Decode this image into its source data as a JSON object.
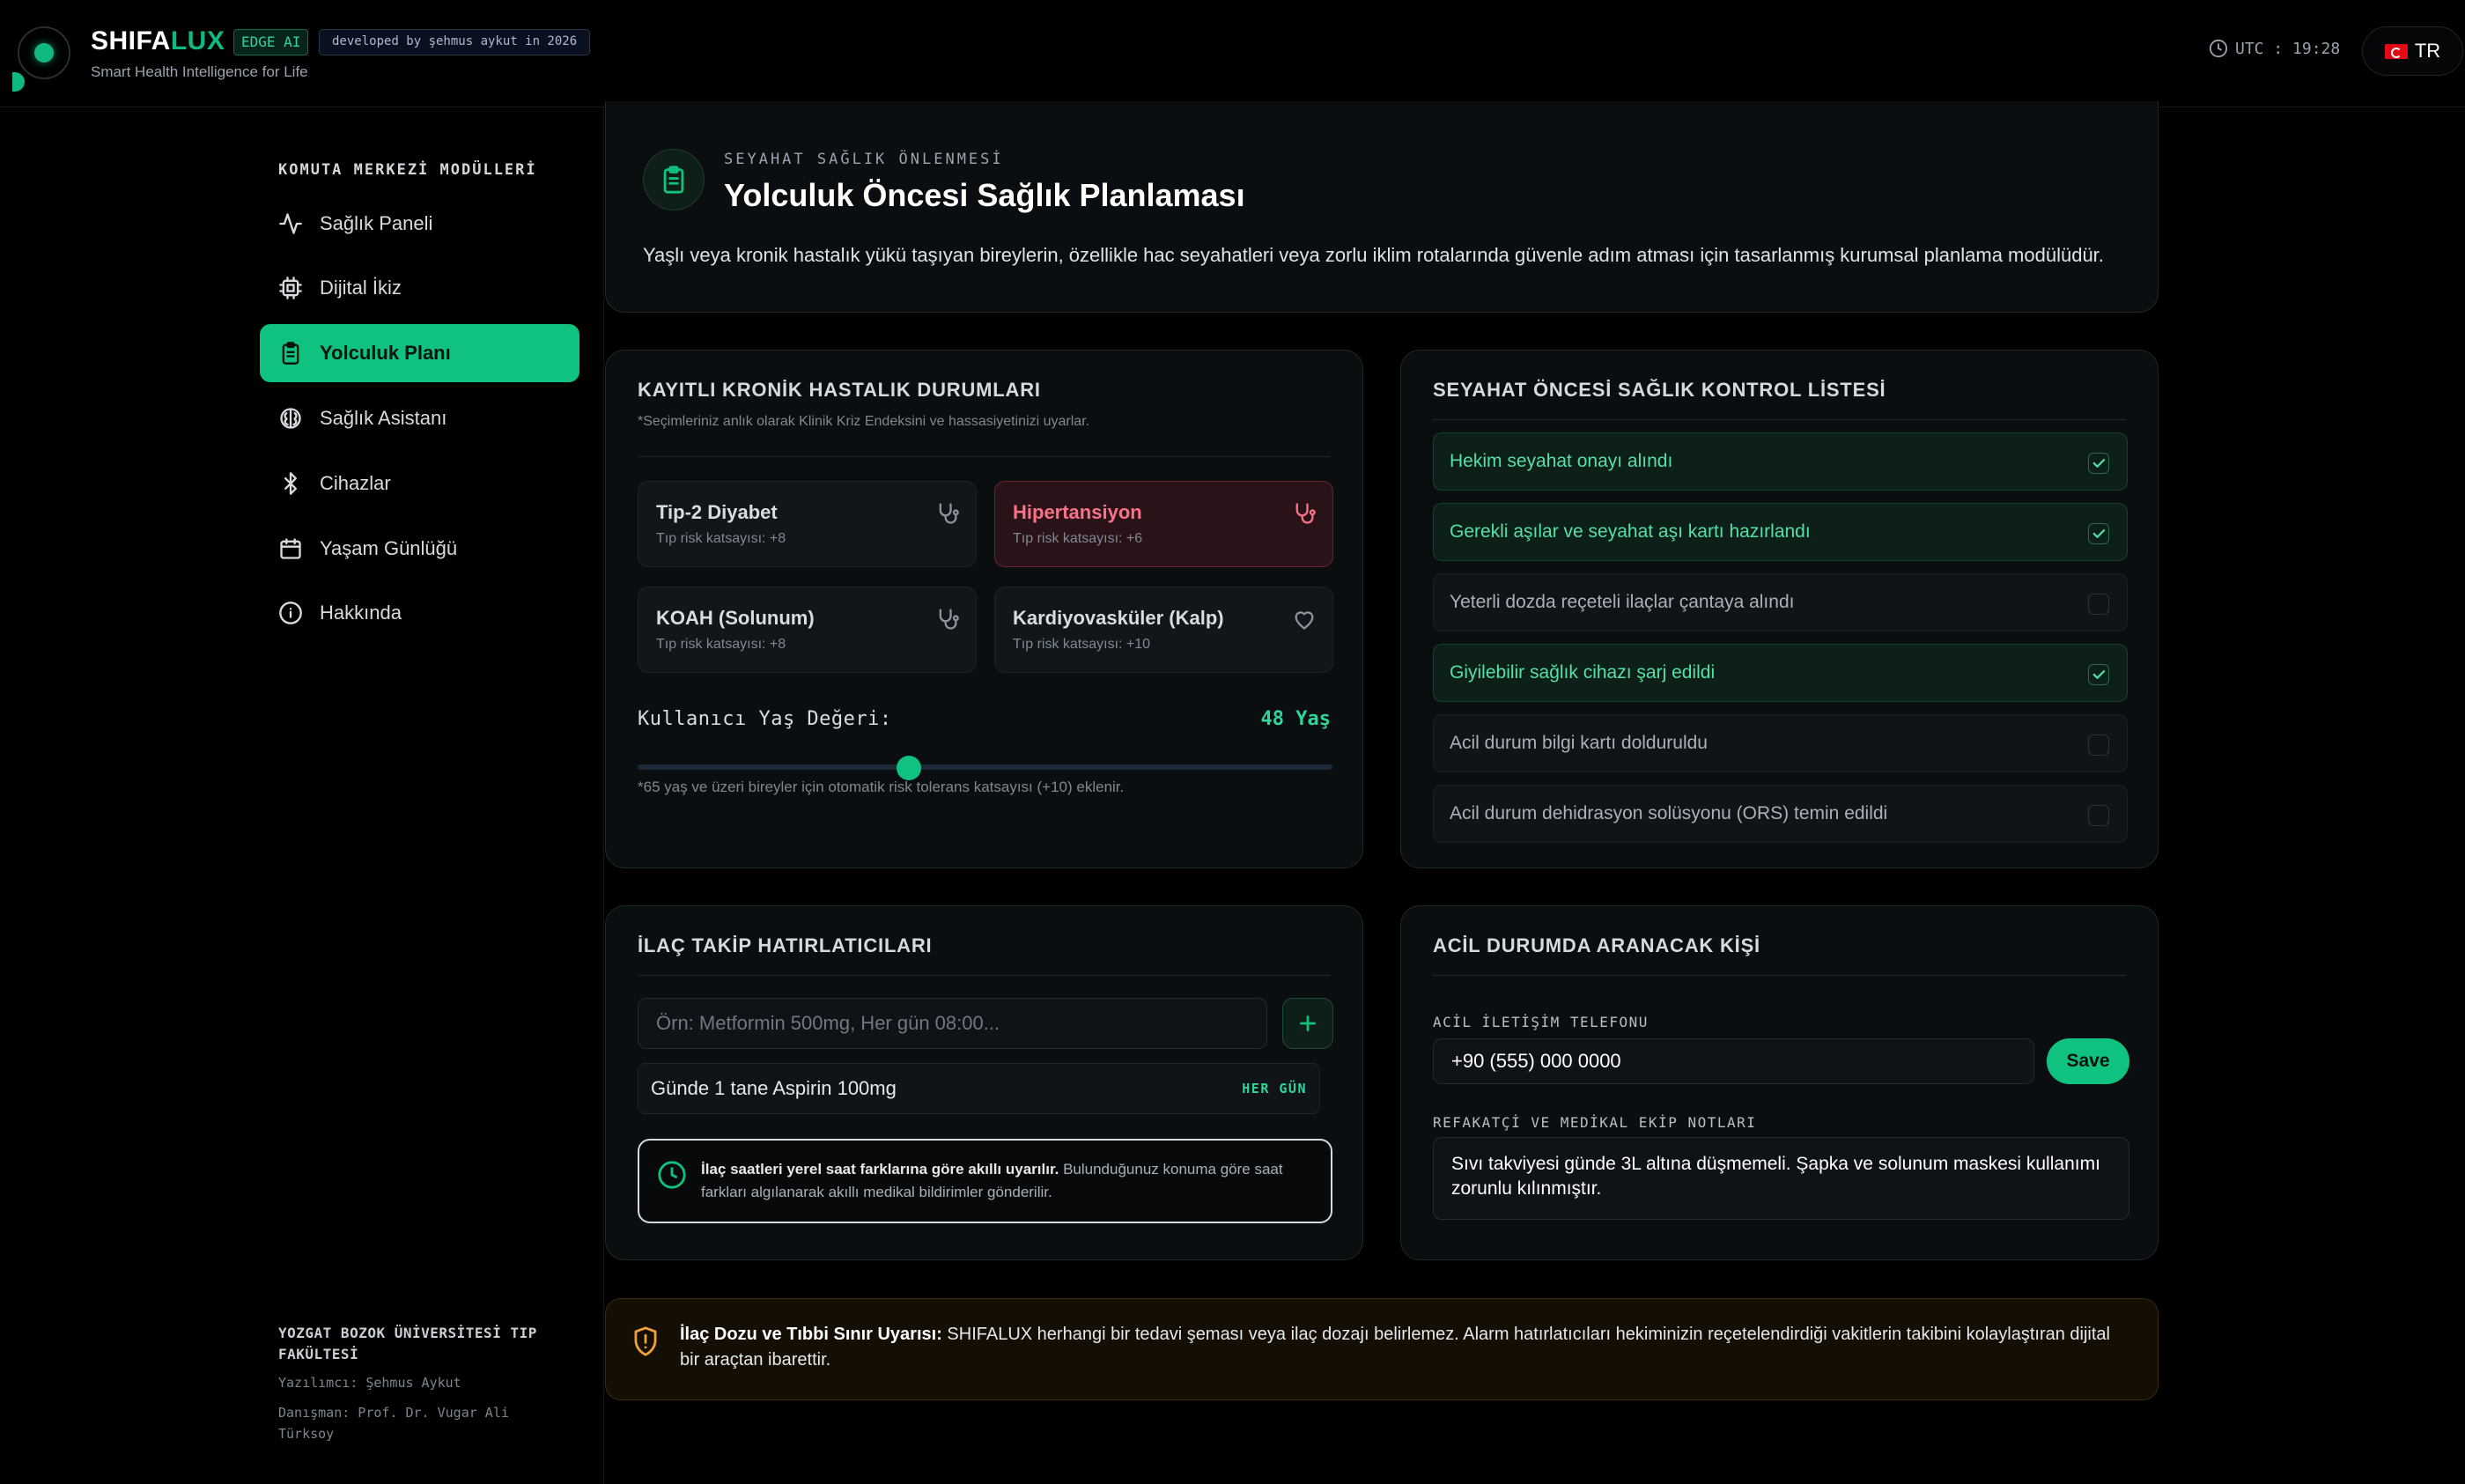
{
  "header": {
    "brand_part1": "SHIFA",
    "brand_part2": "LUX",
    "badge": "EDGE AI",
    "developer_badge": "developed by şehmus aykut in 2026",
    "tagline": "Smart Health Intelligence for Life",
    "clock": "UTC : 19:28",
    "language": "TR"
  },
  "sidebar": {
    "title": "KOMUTA MERKEZİ MODÜLLERİ",
    "items": [
      {
        "label": "Sağlık Paneli",
        "icon": "activity-icon"
      },
      {
        "label": "Dijital İkiz",
        "icon": "cpu-icon"
      },
      {
        "label": "Yolculuk Planı",
        "icon": "clipboard-icon",
        "active": true
      },
      {
        "label": "Sağlık Asistanı",
        "icon": "brain-icon"
      },
      {
        "label": "Cihazlar",
        "icon": "bluetooth-icon"
      },
      {
        "label": "Yaşam Günlüğü",
        "icon": "calendar-icon"
      },
      {
        "label": "Hakkında",
        "icon": "info-icon"
      }
    ],
    "footer": {
      "university": "YOZGAT BOZOK ÜNİVERSİTESİ TIP FAKÜLTESİ",
      "developer": "Yazılımcı: Şehmus Aykut",
      "advisor": "Danışman: Prof. Dr. Vugar Ali Türksoy"
    }
  },
  "page": {
    "eyebrow": "SEYAHAT SAĞLIK ÖNLENMESİ",
    "title": "Yolculuk Öncesi Sağlık Planlaması",
    "description": "Yaşlı veya kronik hastalık yükü taşıyan bireylerin, özellikle hac seyahatleri veya zorlu iklim rotalarında güvenle adım atması için tasarlanmış kurumsal planlama modülüdür."
  },
  "chronic": {
    "title": "KAYITLI KRONİK HASTALIK DURUMLARI",
    "subtitle": "*Seçimleriniz anlık olarak Klinik Kriz Endeksini ve hassasiyetinizi uyarlar.",
    "diseases": [
      {
        "name": "Tip-2 Diyabet",
        "risk": "Tıp risk katsayısı: +8",
        "selected": false,
        "icon": "stethoscope-icon"
      },
      {
        "name": "Hipertansiyon",
        "risk": "Tıp risk katsayısı: +6",
        "selected": true,
        "icon": "stethoscope-icon"
      },
      {
        "name": "KOAH (Solunum)",
        "risk": "Tıp risk katsayısı: +8",
        "selected": false,
        "icon": "stethoscope-icon"
      },
      {
        "name": "Kardiyovasküler (Kalp)",
        "risk": "Tıp risk katsayısı: +10",
        "selected": false,
        "icon": "heart-icon"
      }
    ],
    "age_label": "Kullanıcı Yaş Değeri:",
    "age_value": "48 Yaş",
    "age_slider_fraction": 0.39,
    "age_note": "*65 yaş ve üzeri bireyler için otomatik risk tolerans katsayısı (+10) eklenir."
  },
  "checklist": {
    "title": "SEYAHAT ÖNCESİ SAĞLIK KONTROL LİSTESİ",
    "items": [
      {
        "label": "Hekim seyahat onayı alındı",
        "checked": true
      },
      {
        "label": "Gerekli aşılar ve seyahat aşı kartı hazırlandı",
        "checked": true
      },
      {
        "label": "Yeterli dozda reçeteli ilaçlar çantaya alındı",
        "checked": false
      },
      {
        "label": "Giyilebilir sağlık cihazı şarj edildi",
        "checked": true
      },
      {
        "label": "Acil durum bilgi kartı dolduruldu",
        "checked": false
      },
      {
        "label": "Acil durum dehidrasyon solüsyonu (ORS) temin edildi",
        "checked": false
      }
    ]
  },
  "meds": {
    "title": "İLAÇ TAKİP HATIRLATICILARI",
    "placeholder": "Örn: Metformin 500mg, Her gün 08:00...",
    "entries": [
      {
        "name": "Günde 1 tane Aspirin 100mg",
        "frequency": "HER GÜN"
      }
    ],
    "info_bold": "İlaç saatleri yerel saat farklarına göre akıllı uyarılır.",
    "info_text": " Bulunduğunuz konuma göre saat farkları algılanarak akıllı medikal bildirimler gönderilir."
  },
  "emergency": {
    "title": "ACİL DURUMDA ARANACAK KİŞİ",
    "phone_label": "ACİL İLETİŞİM TELEFONU",
    "phone_value": "+90 (555) 000 0000",
    "save_label": "Save",
    "notes_label": "REFAKATÇİ VE MEDİKAL EKİP NOTLARI",
    "notes_value": "Sıvı takviyesi günde 3L altına düşmemeli. Şapka ve solunum maskesi kullanımı zorunlu kılınmıştır."
  },
  "warning": {
    "bold": "İlaç Dozu ve Tıbbi Sınır Uyarısı:",
    "text": " SHIFALUX herhangi bir tedavi şeması veya ilaç dozajı belirlemez. Alarm hatırlatıcıları hekiminizin reçetelendirdiği vakitlerin takibini kolaylaştıran dijital bir araçtan ibarettir."
  },
  "colors": {
    "accent": "#10c27f",
    "danger": "#fb7185",
    "background": "#000000"
  }
}
